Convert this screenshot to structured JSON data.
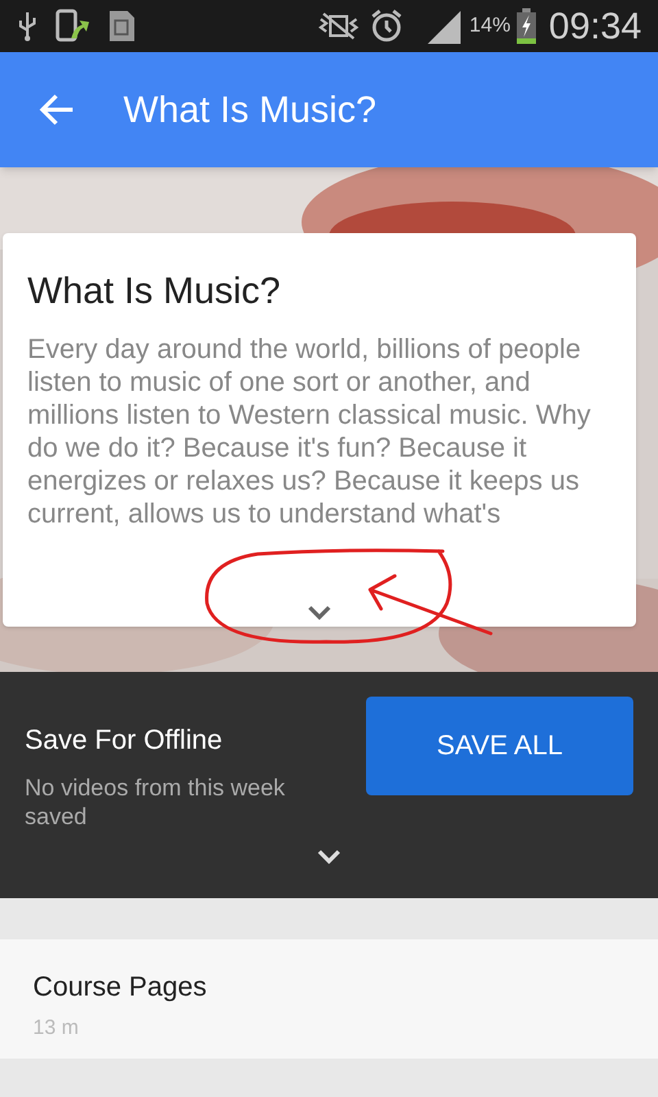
{
  "status_bar": {
    "battery": "14%",
    "time": "09:34"
  },
  "app_bar": {
    "title": "What Is Music?"
  },
  "summary_card": {
    "title": "What Is Music?",
    "description": "Every day around the world, billions of people listen to music of one sort or another, and millions listen to Western classical music. Why do we do it? Because it's fun? Because it energizes or relaxes us? Because it keeps us current, allows us to understand what's",
    "expanded": false
  },
  "offline": {
    "title": "Save For Offline",
    "subtitle": "No videos from this week saved",
    "button": "SAVE ALL",
    "expanded": false
  },
  "sections": [
    {
      "title": "Course Pages",
      "meta": "13 m"
    }
  ]
}
